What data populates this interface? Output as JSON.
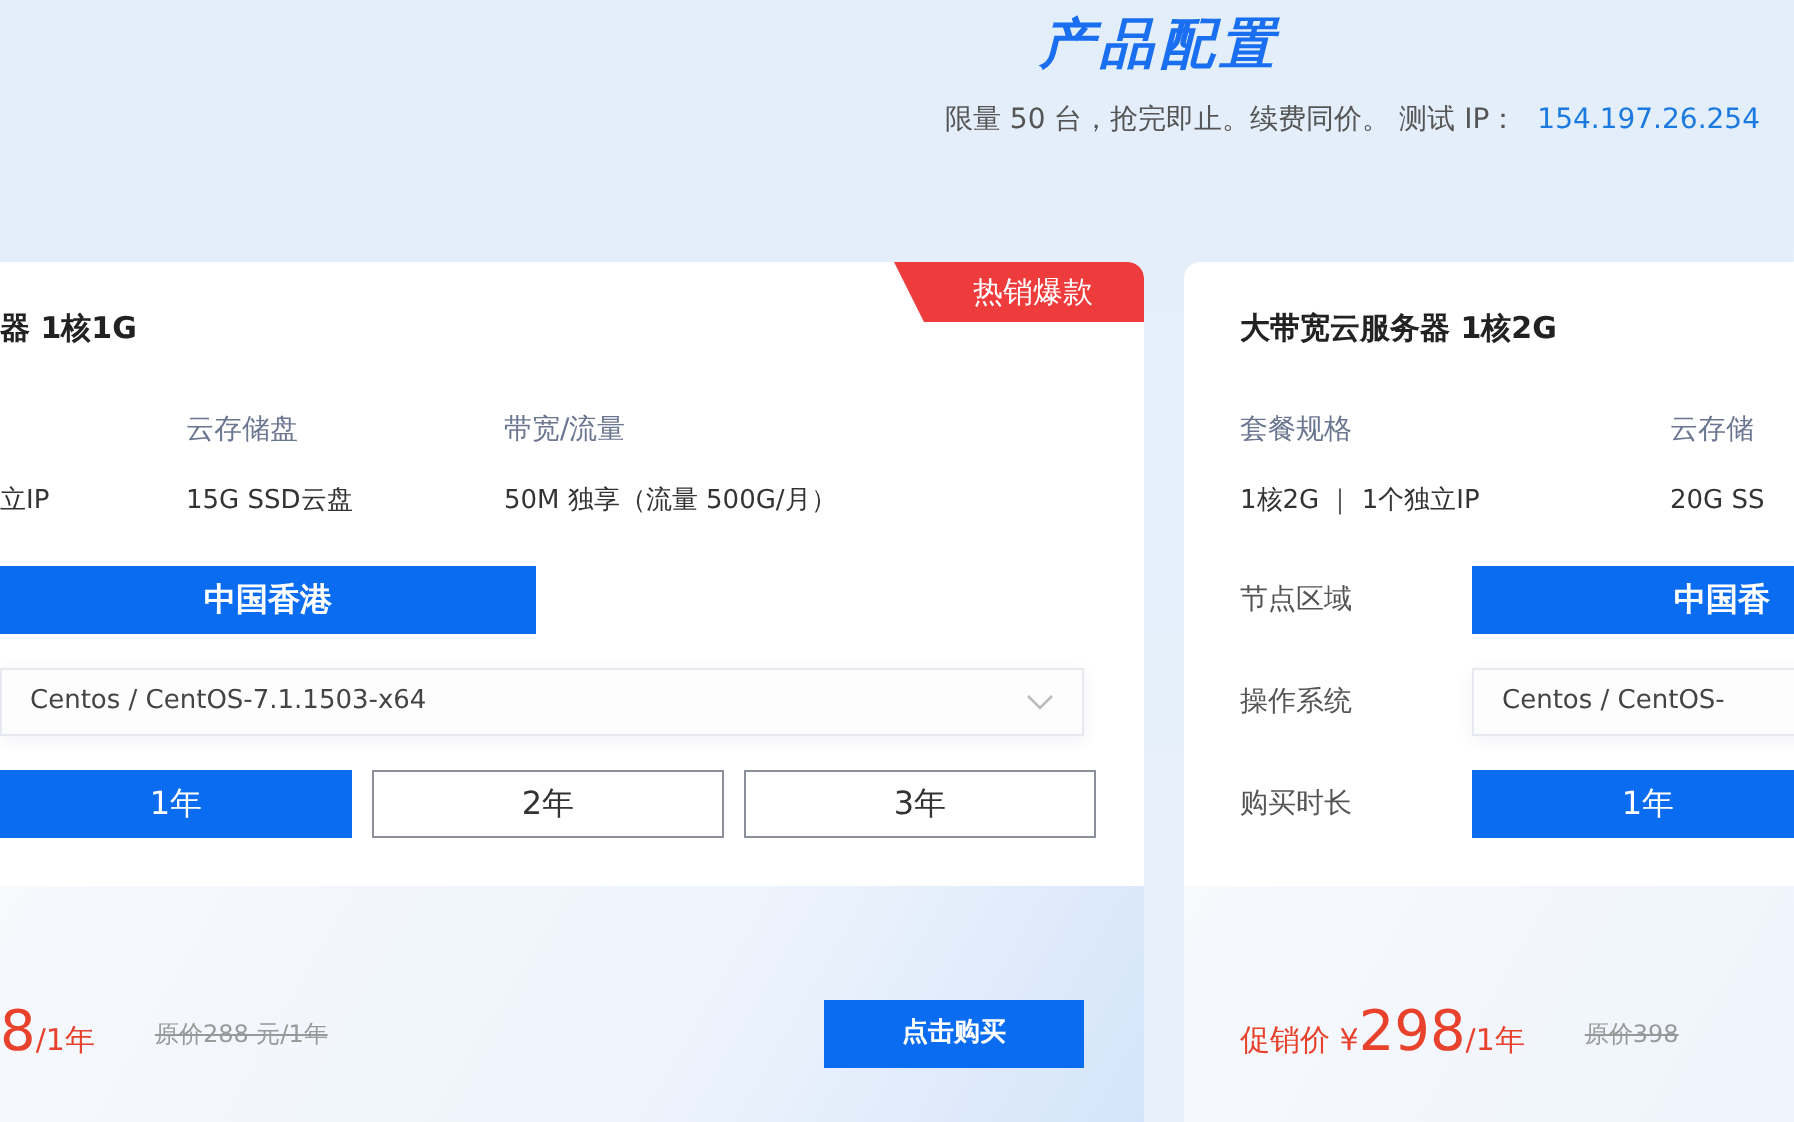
{
  "header": {
    "title": "产品配置",
    "subtitle": "限量 50 台，抢完即止。续费同价。 测试 IP：",
    "test_ip": "154.197.26.254"
  },
  "cards": [
    {
      "title": "器 1核1G",
      "badge": "热销爆款",
      "specs": [
        {
          "value": "立IP"
        },
        {
          "label": "云存储盘",
          "value": "15G SSD云盘"
        },
        {
          "label": "带宽/流量",
          "value": "50M 独享（流量 500G/月）"
        }
      ],
      "options": [
        {
          "kind": "choice",
          "choices": [
            {
              "label": "中国香港",
              "selected": true
            }
          ]
        },
        {
          "kind": "select",
          "value": "Centos / CentOS-7.1.1503-x64"
        },
        {
          "kind": "choice",
          "choices": [
            {
              "label": "1年",
              "selected": true
            },
            {
              "label": "2年",
              "selected": false
            },
            {
              "label": "3年",
              "selected": false
            }
          ]
        }
      ],
      "price": {
        "amount": "8",
        "unit": "/1年",
        "original": "原价288 元/1年"
      },
      "buy_button": "点击购买"
    },
    {
      "title": "大带宽云服务器 1核2G",
      "specs": [
        {
          "label": "套餐规格",
          "value": "1核2G ｜ 1个独立IP"
        },
        {
          "label": "云存储",
          "value": "20G SS"
        }
      ],
      "options": [
        {
          "kind": "choice",
          "label": "节点区域",
          "choices": [
            {
              "label": "中国香",
              "selected": true
            }
          ]
        },
        {
          "kind": "select",
          "label": "操作系统",
          "value": "Centos / CentOS-"
        },
        {
          "kind": "choice",
          "label": "购买时长",
          "choices": [
            {
              "label": "1年",
              "selected": true
            }
          ]
        }
      ],
      "price": {
        "label": "促销价",
        "currency": "¥",
        "amount": "298",
        "unit": "/1年",
        "original": "原价398"
      }
    }
  ]
}
